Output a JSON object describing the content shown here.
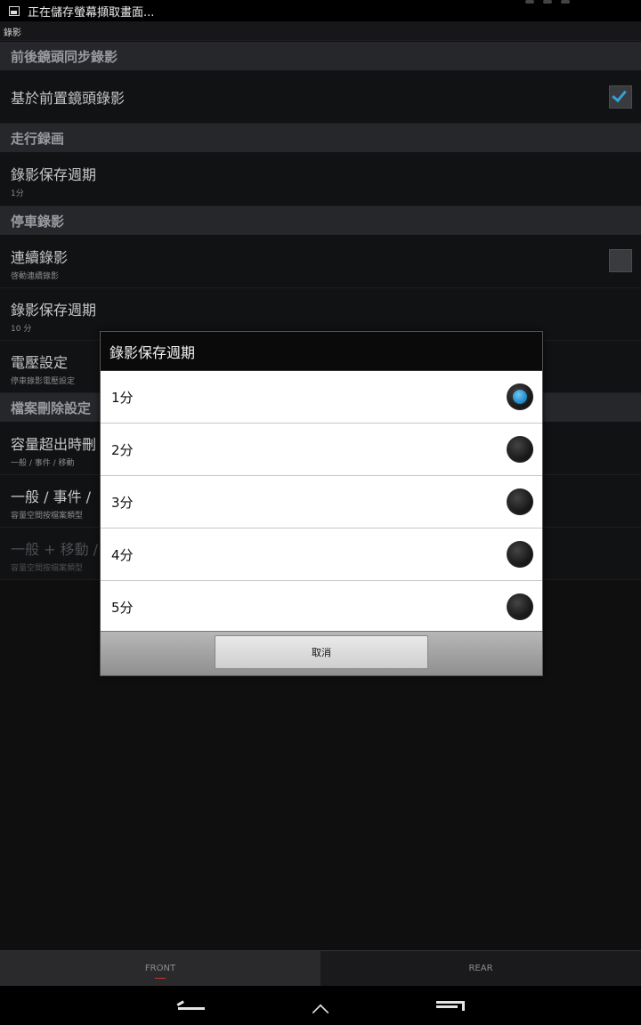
{
  "status_bar": {
    "text": "正在儲存螢幕擷取畫面..."
  },
  "app_bar": {
    "title": "錄影"
  },
  "settings": {
    "section_sync": "前後鏡頭同步錄影",
    "item_front_based": {
      "title": "基於前置鏡頭錄影",
      "checked": true
    },
    "section_drive": "走行録画",
    "item_drive_period": {
      "title": "錄影保存週期",
      "summary": "1分"
    },
    "section_parking": "停車錄影",
    "item_continuous": {
      "title": "連續錄影",
      "summary": "啓動連續錄影",
      "checked": false
    },
    "item_parking_period": {
      "title": "錄影保存週期",
      "summary": "10 分"
    },
    "item_voltage": {
      "title": "電壓設定",
      "summary": "停車錄影電壓設定"
    },
    "section_delete": "檔案刪除設定",
    "item_capacity": {
      "title": "容量超出時刪",
      "summary": "一般 / 事件 / 移動"
    },
    "item_general_event": {
      "title": "一般 / 事件 /",
      "summary": "容量空間按檔案類型"
    },
    "item_general_motion": {
      "title": "一般 + 移動 /",
      "summary": "容量空間按檔案類型"
    }
  },
  "dialog": {
    "title": "錄影保存週期",
    "options": [
      {
        "label": "1分",
        "selected": true
      },
      {
        "label": "2分",
        "selected": false
      },
      {
        "label": "3分",
        "selected": false
      },
      {
        "label": "4分",
        "selected": false
      },
      {
        "label": "5分",
        "selected": false
      }
    ],
    "cancel_label": "取消"
  },
  "bottom_tabs": {
    "front": "FRONT",
    "rear": "REAR"
  },
  "colors": {
    "accent": "#35a0d8",
    "section_bg": "#26272b",
    "item_bg": "#111214"
  }
}
